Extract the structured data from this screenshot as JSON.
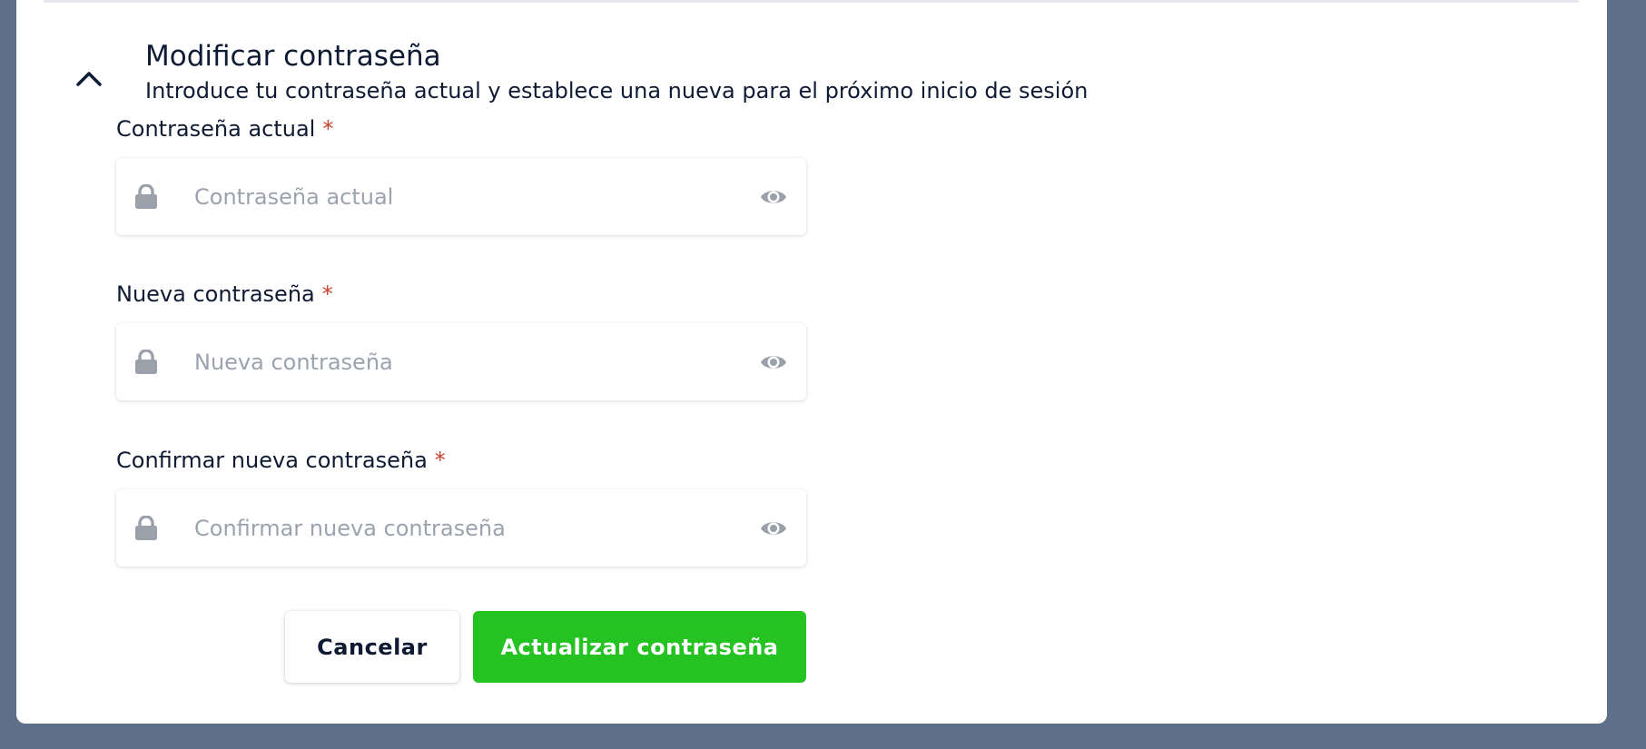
{
  "section": {
    "title": "Modificar contraseña",
    "subtitle": "Introduce tu contraseña actual y establece una nueva para el próximo inicio de sesión"
  },
  "fields": {
    "current": {
      "label": "Contraseña actual",
      "required_mark": "*",
      "placeholder": "Contraseña actual",
      "value": ""
    },
    "new": {
      "label": "Nueva contraseña",
      "required_mark": "*",
      "placeholder": "Nueva contraseña",
      "value": ""
    },
    "confirm": {
      "label": "Confirmar nueva contraseña",
      "required_mark": "*",
      "placeholder": "Confirmar nueva contraseña",
      "value": ""
    }
  },
  "buttons": {
    "cancel_label": "Cancelar",
    "submit_label": "Actualizar contraseña"
  },
  "icons": {
    "collapse": "chevron-up-icon",
    "lock": "lock-icon",
    "toggle_visibility": "eye-icon"
  },
  "colors": {
    "background": "#5e7089",
    "card": "#ffffff",
    "text": "#0f1b33",
    "required": "#c8412f",
    "placeholder": "#9ca3af",
    "icon": "#9aa1ab",
    "primary_button": "#24c322"
  }
}
